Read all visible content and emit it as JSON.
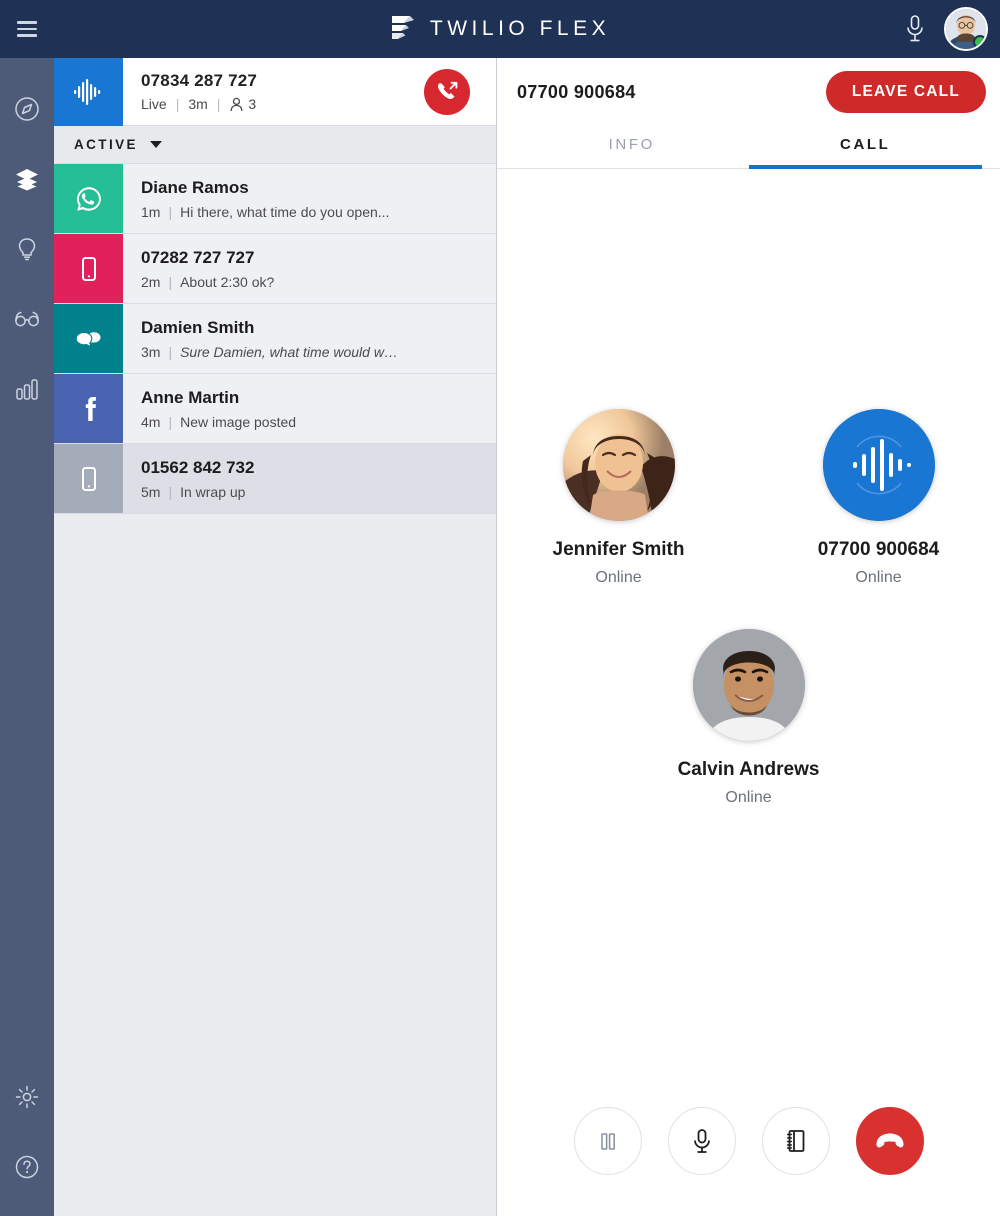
{
  "topbar": {
    "menu_icon": "hamburger-menu-icon",
    "brand_name": "TWILIO FLEX",
    "logo_icon": "twilio-flex-logo-icon",
    "mic_icon": "microphone-icon",
    "agent_avatar_icon": "agent-avatar",
    "agent_status": "available",
    "status_color": "#36C04B",
    "background_color": "#1F3154"
  },
  "rail": {
    "background_color": "#4D5B79",
    "items": [
      {
        "icon": "compass-icon",
        "label": "Agent Desktop",
        "active": false
      },
      {
        "icon": "layers-icon",
        "label": "Tasks",
        "active": true
      },
      {
        "icon": "lightbulb-icon",
        "label": "Insights",
        "active": false
      },
      {
        "icon": "glasses-icon",
        "label": "Monitoring",
        "active": false
      },
      {
        "icon": "bar-chart-icon",
        "label": "Analytics",
        "active": false
      }
    ],
    "bottom_items": [
      {
        "icon": "gear-icon",
        "label": "Settings"
      },
      {
        "icon": "help-circle-icon",
        "label": "Help"
      }
    ]
  },
  "active_call": {
    "channel_icon": "voice-waveform-icon",
    "channel_color": "#1976D2",
    "title": "07834 287 727",
    "status": "Live",
    "duration": "3m",
    "participants_icon": "person-icon",
    "participants_count": "3",
    "action_icon": "outbound-call-icon",
    "action_color": "#D8282F"
  },
  "filter": {
    "label": "ACTIVE",
    "caret_icon": "chevron-down-icon"
  },
  "tasks": [
    {
      "name": "Diane Ramos",
      "time": "1m",
      "message": "Hi there, what time do you open...",
      "italic": false,
      "channel_icon": "whatsapp-icon",
      "channel_color": "#26BE96",
      "selected": false
    },
    {
      "name": "07282 727 727",
      "time": "2m",
      "message": "About 2:30 ok?",
      "italic": false,
      "channel_icon": "sms-phone-icon",
      "channel_color": "#E0215B",
      "selected": false
    },
    {
      "name": "Damien Smith",
      "time": "3m",
      "message": "Sure Damien, what time would w…",
      "italic": true,
      "channel_icon": "chat-bubbles-icon",
      "channel_color": "#00818C",
      "selected": false
    },
    {
      "name": "Anne Martin",
      "time": "4m",
      "message": "New image posted",
      "italic": false,
      "channel_icon": "facebook-icon",
      "channel_color": "#4A63B0",
      "selected": false
    },
    {
      "name": "01562 842 732",
      "time": "5m",
      "message": "In wrap up",
      "italic": false,
      "channel_icon": "sms-phone-icon",
      "channel_color": "#A4ACBA",
      "selected": true
    }
  ],
  "call_panel": {
    "number": "07700 900684",
    "leave_call_label": "LEAVE CALL",
    "leave_call_color": "#CE2A29",
    "tabs": [
      {
        "label": "INFO",
        "active": false
      },
      {
        "label": "CALL",
        "active": true
      }
    ],
    "active_tab_color": "#1472D1",
    "participants": [
      {
        "name": "Jennifer Smith",
        "status": "Online",
        "avatar_icon": "customer-photo-avatar"
      },
      {
        "name": "07700 900684",
        "status": "Online",
        "avatar_icon": "voice-waveform-avatar"
      },
      {
        "name": "Calvin Andrews",
        "status": "Online",
        "avatar_icon": "agent-photo-avatar"
      }
    ],
    "controls": [
      {
        "icon": "pause-icon",
        "label": "Hold",
        "danger": false
      },
      {
        "icon": "microphone-icon",
        "label": "Mute",
        "danger": false
      },
      {
        "icon": "directory-icon",
        "label": "Directory",
        "danger": false
      },
      {
        "icon": "hangup-icon",
        "label": "Hang Up",
        "danger": true
      }
    ]
  }
}
